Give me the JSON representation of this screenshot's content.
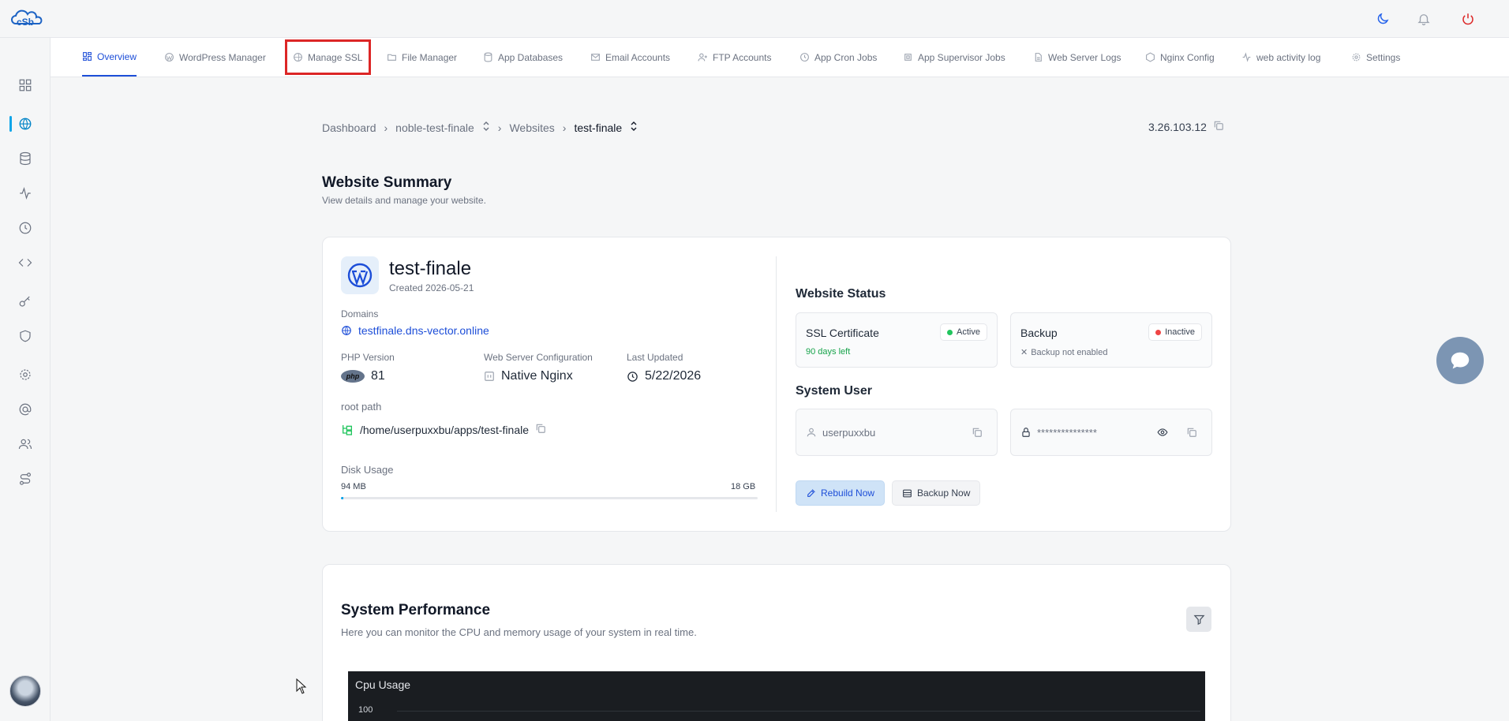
{
  "app": {
    "logo_text": "cSb"
  },
  "topbar": {
    "icons": [
      "moon-icon",
      "bell-icon",
      "power-icon"
    ]
  },
  "sidebar": {
    "items": [
      "dashboard-icon",
      "websites-icon",
      "database-icon",
      "activity-icon",
      "clock-icon",
      "code-icon",
      "key-icon",
      "shield-icon",
      "gear-icon",
      "at-icon",
      "users-icon",
      "route-icon"
    ],
    "active_index": 1
  },
  "tabs": [
    {
      "label": "Overview",
      "icon": "layout-icon"
    },
    {
      "label": "WordPress Manager",
      "icon": "wordpress-icon"
    },
    {
      "label": "Manage SSL",
      "icon": "globe-lock-icon"
    },
    {
      "label": "File Manager",
      "icon": "folder-icon"
    },
    {
      "label": "App Databases",
      "icon": "database-icon"
    },
    {
      "label": "Email Accounts",
      "icon": "mail-icon"
    },
    {
      "label": "FTP Accounts",
      "icon": "user-plus-icon"
    },
    {
      "label": "App Cron Jobs",
      "icon": "clock-icon"
    },
    {
      "label": "App Supervisor Jobs",
      "icon": "cpu-icon"
    },
    {
      "label": "Web Server Logs",
      "icon": "file-icon"
    },
    {
      "label": "Nginx Config",
      "icon": "hexagon-icon"
    },
    {
      "label": "web activity log",
      "icon": "activity-icon"
    },
    {
      "label": "Settings",
      "icon": "gear-icon"
    }
  ],
  "breadcrumb": {
    "dashboard": "Dashboard",
    "server": "noble-test-finale",
    "websites": "Websites",
    "current": "test-finale"
  },
  "server_ip": "3.26.103.12",
  "summary": {
    "title": "Website Summary",
    "subtitle": "View details and manage your website.",
    "site_name": "test-finale",
    "created": "Created 2026-05-21",
    "domains_label": "Domains",
    "domain": "testfinale.dns-vector.online",
    "php_label": "PHP Version",
    "php_value": "81",
    "php_badge": "php",
    "webserver_label": "Web Server Configuration",
    "webserver_value": "Native Nginx",
    "updated_label": "Last Updated",
    "updated_value": "5/22/2026",
    "root_label": "root path",
    "root_value": "/home/userpuxxbu/apps/test-finale",
    "disk_label": "Disk Usage",
    "disk_used": "94 MB",
    "disk_total": "18 GB",
    "disk_fraction": 0.005
  },
  "status": {
    "title": "Website Status",
    "ssl": {
      "name": "SSL Certificate",
      "state": "Active",
      "sub": "90 days left",
      "color": "#22c55e"
    },
    "backup": {
      "name": "Backup",
      "state": "Inactive",
      "sub": "Backup not enabled",
      "color": "#ef4444"
    }
  },
  "system_user": {
    "title": "System User",
    "username": "userpuxxbu",
    "password_mask": "***************"
  },
  "actions": {
    "rebuild": "Rebuild Now",
    "backup": "Backup Now"
  },
  "performance": {
    "title": "System Performance",
    "subtitle": "Here you can monitor the CPU and memory usage of your system in real time.",
    "chart_title": "Cpu Usage",
    "chart_top_tick": "100"
  }
}
